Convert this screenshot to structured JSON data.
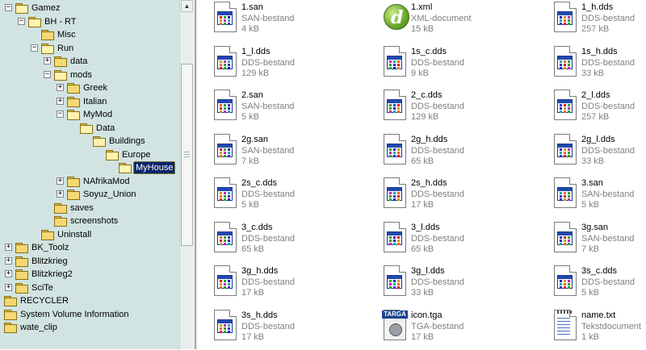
{
  "tree": {
    "items": [
      {
        "label": "Gamez",
        "level": 0,
        "expander": "minus",
        "icon": "folder-open",
        "selected": false
      },
      {
        "label": "BH - RT",
        "level": 1,
        "expander": "minus",
        "icon": "folder-open",
        "selected": false
      },
      {
        "label": "Misc",
        "level": 2,
        "expander": "none",
        "icon": "folder",
        "selected": false
      },
      {
        "label": "Run",
        "level": 2,
        "expander": "minus",
        "icon": "folder-open",
        "selected": false
      },
      {
        "label": "data",
        "level": 3,
        "expander": "plus",
        "icon": "folder",
        "selected": false
      },
      {
        "label": "mods",
        "level": 3,
        "expander": "minus",
        "icon": "folder-open",
        "selected": false
      },
      {
        "label": "Greek",
        "level": 4,
        "expander": "plus",
        "icon": "folder",
        "selected": false
      },
      {
        "label": "Italian",
        "level": 4,
        "expander": "plus",
        "icon": "folder",
        "selected": false
      },
      {
        "label": "MyMod",
        "level": 4,
        "expander": "minus",
        "icon": "folder-open",
        "selected": false
      },
      {
        "label": "Data",
        "level": 5,
        "expander": "none",
        "icon": "folder-open",
        "selected": false
      },
      {
        "label": "Buildings",
        "level": 6,
        "expander": "none",
        "icon": "folder-open",
        "selected": false
      },
      {
        "label": "Europe",
        "level": 7,
        "expander": "none",
        "icon": "folder-open",
        "selected": false
      },
      {
        "label": "MyHouse",
        "level": 8,
        "expander": "none",
        "icon": "folder-open",
        "selected": true
      },
      {
        "label": "NAfrikaMod",
        "level": 4,
        "expander": "plus",
        "icon": "folder",
        "selected": false
      },
      {
        "label": "Soyuz_Union",
        "level": 4,
        "expander": "plus",
        "icon": "folder",
        "selected": false
      },
      {
        "label": "saves",
        "level": 3,
        "expander": "none",
        "icon": "folder",
        "selected": false
      },
      {
        "label": "screenshots",
        "level": 3,
        "expander": "none",
        "icon": "folder",
        "selected": false
      },
      {
        "label": "Uninstall",
        "level": 2,
        "expander": "none",
        "icon": "folder",
        "selected": false
      },
      {
        "label": "BK_Toolz",
        "level": 0,
        "expander": "plus",
        "icon": "folder",
        "selected": false
      },
      {
        "label": "Blitzkrieg",
        "level": 0,
        "expander": "plus",
        "icon": "folder",
        "selected": false
      },
      {
        "label": "Blitzkrieg2",
        "level": 0,
        "expander": "plus",
        "icon": "folder",
        "selected": false
      },
      {
        "label": "SciTe",
        "level": 0,
        "expander": "plus",
        "icon": "folder",
        "selected": false
      },
      {
        "label": "RECYCLER",
        "level": -1,
        "expander": "none",
        "icon": "folder",
        "selected": false
      },
      {
        "label": "System Volume Information",
        "level": -1,
        "expander": "none",
        "icon": "folder",
        "selected": false
      },
      {
        "label": "wate_clip",
        "level": -1,
        "expander": "none",
        "icon": "folder",
        "selected": false
      }
    ]
  },
  "files": [
    {
      "name": "1.san",
      "type": "SAN-bestand",
      "size": "4 kB",
      "icon": "generic-document-icon"
    },
    {
      "name": "1.xml",
      "type": "XML-document",
      "size": "15 kB",
      "icon": "xml-document-icon"
    },
    {
      "name": "1_h.dds",
      "type": "DDS-bestand",
      "size": "257 kB",
      "icon": "generic-document-icon"
    },
    {
      "name": "1_l.dds",
      "type": "DDS-bestand",
      "size": "129 kB",
      "icon": "generic-document-icon"
    },
    {
      "name": "1s_c.dds",
      "type": "DDS-bestand",
      "size": "9 kB",
      "icon": "generic-document-icon"
    },
    {
      "name": "1s_h.dds",
      "type": "DDS-bestand",
      "size": "33 kB",
      "icon": "generic-document-icon"
    },
    {
      "name": "2.san",
      "type": "SAN-bestand",
      "size": "5 kB",
      "icon": "generic-document-icon"
    },
    {
      "name": "2_c.dds",
      "type": "DDS-bestand",
      "size": "129 kB",
      "icon": "generic-document-icon"
    },
    {
      "name": "2_l.dds",
      "type": "DDS-bestand",
      "size": "257 kB",
      "icon": "generic-document-icon"
    },
    {
      "name": "2g.san",
      "type": "SAN-bestand",
      "size": "7 kB",
      "icon": "generic-document-icon"
    },
    {
      "name": "2g_h.dds",
      "type": "DDS-bestand",
      "size": "65 kB",
      "icon": "generic-document-icon"
    },
    {
      "name": "2g_l.dds",
      "type": "DDS-bestand",
      "size": "33 kB",
      "icon": "generic-document-icon"
    },
    {
      "name": "2s_c.dds",
      "type": "DDS-bestand",
      "size": "5 kB",
      "icon": "generic-document-icon"
    },
    {
      "name": "2s_h.dds",
      "type": "DDS-bestand",
      "size": "17 kB",
      "icon": "generic-document-icon"
    },
    {
      "name": "3.san",
      "type": "SAN-bestand",
      "size": "5 kB",
      "icon": "generic-document-icon"
    },
    {
      "name": "3_c.dds",
      "type": "DDS-bestand",
      "size": "65 kB",
      "icon": "generic-document-icon"
    },
    {
      "name": "3_l.dds",
      "type": "DDS-bestand",
      "size": "65 kB",
      "icon": "generic-document-icon"
    },
    {
      "name": "3g.san",
      "type": "SAN-bestand",
      "size": "7 kB",
      "icon": "generic-document-icon"
    },
    {
      "name": "3g_h.dds",
      "type": "DDS-bestand",
      "size": "17 kB",
      "icon": "generic-document-icon"
    },
    {
      "name": "3g_l.dds",
      "type": "DDS-bestand",
      "size": "33 kB",
      "icon": "generic-document-icon"
    },
    {
      "name": "3s_c.dds",
      "type": "DDS-bestand",
      "size": "5 kB",
      "icon": "generic-document-icon"
    },
    {
      "name": "3s_h.dds",
      "type": "DDS-bestand",
      "size": "17 kB",
      "icon": "generic-document-icon"
    },
    {
      "name": "icon.tga",
      "type": "TGA-bestand",
      "size": "17 kB",
      "icon": "targa-image-icon",
      "badge": "TARGA"
    },
    {
      "name": "name.txt",
      "type": "Tekstdocument",
      "size": "1 kB",
      "icon": "text-document-icon"
    }
  ],
  "colors": {
    "tree_bg": "#d1e4e1",
    "selection_bg": "#0a246a",
    "meta_text": "#808080"
  }
}
